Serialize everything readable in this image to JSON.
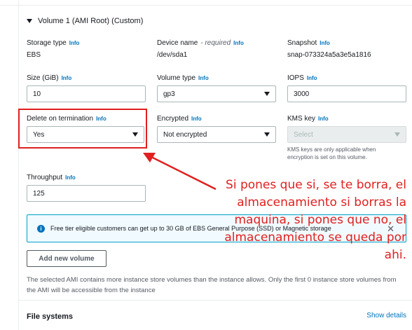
{
  "volume": {
    "title": "Volume 1 (AMI Root) (Custom)"
  },
  "info_label": "Info",
  "fields": {
    "storage_type": {
      "label": "Storage type",
      "value": "EBS"
    },
    "device_name": {
      "label": "Device name",
      "required": "- required",
      "value": "/dev/sda1"
    },
    "snapshot": {
      "label": "Snapshot",
      "value": "snap-073324a5a3e5a1816"
    },
    "size": {
      "label": "Size (GiB)",
      "value": "10"
    },
    "volume_type": {
      "label": "Volume type",
      "value": "gp3"
    },
    "iops": {
      "label": "IOPS",
      "value": "3000"
    },
    "delete_on_termination": {
      "label": "Delete on termination",
      "value": "Yes"
    },
    "encrypted": {
      "label": "Encrypted",
      "value": "Not encrypted"
    },
    "kms_key": {
      "label": "KMS key",
      "placeholder": "Select",
      "hint": "KMS keys are only applicable when encryption is set on this volume."
    },
    "throughput": {
      "label": "Throughput",
      "value": "125"
    }
  },
  "annotation": {
    "text": "Si pones que si, se te borra, el almacenamiento si borras la maquina, si pones que no, el almacenamiento se queda por ahi.",
    "color": "#e02020"
  },
  "banner": {
    "text": "Free tier eligible customers can get up to 30 GB of EBS General Purpose (SSD) or Magnetic storage",
    "icon": "info-circle-icon",
    "close_icon": "close-icon"
  },
  "add_volume_button": "Add new volume",
  "notice": "The selected AMI contains more instance store volumes than the instance allows. Only the first 0 instance store volumes from the AMI will be accessible from the instance",
  "file_systems": {
    "title": "File systems",
    "link": "Show details"
  }
}
